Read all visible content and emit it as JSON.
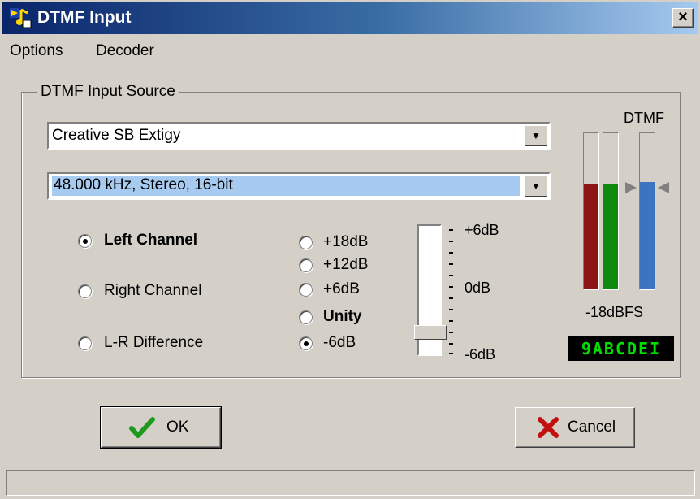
{
  "window": {
    "title": "DTMF Input",
    "close_symbol": "×"
  },
  "menu": {
    "options": "Options",
    "decoder": "Decoder"
  },
  "group": {
    "label": "DTMF Input Source"
  },
  "device_combo": {
    "value": "Creative SB Extigy"
  },
  "format_combo": {
    "value": "48.000 kHz, Stereo, 16-bit"
  },
  "channels": [
    {
      "label": "Left Channel",
      "checked": true
    },
    {
      "label": "Right Channel",
      "checked": false
    },
    {
      "label": "L-R Difference",
      "checked": false
    }
  ],
  "gains": [
    {
      "label": "+18dB",
      "checked": false
    },
    {
      "label": "+12dB",
      "checked": false
    },
    {
      "label": "+6dB",
      "checked": false
    },
    {
      "label": "Unity",
      "checked": false
    },
    {
      "label": "-6dB",
      "checked": true
    }
  ],
  "slider": {
    "top_label": "+6dB",
    "mid_label": "0dB",
    "bottom_label": "-6dB",
    "value_db": -6
  },
  "meters": {
    "title": "DTMF",
    "level_label": "-18dBFS",
    "left_level": 0.67,
    "right_level": 0.67,
    "dtmf_level": 0.69,
    "colors": {
      "left": "#8b1515",
      "right": "#0f8a0f",
      "dtmf": "#3c74c2"
    }
  },
  "decoded_digits": "9ABCDEI",
  "buttons": {
    "ok": "OK",
    "cancel": "Cancel"
  }
}
